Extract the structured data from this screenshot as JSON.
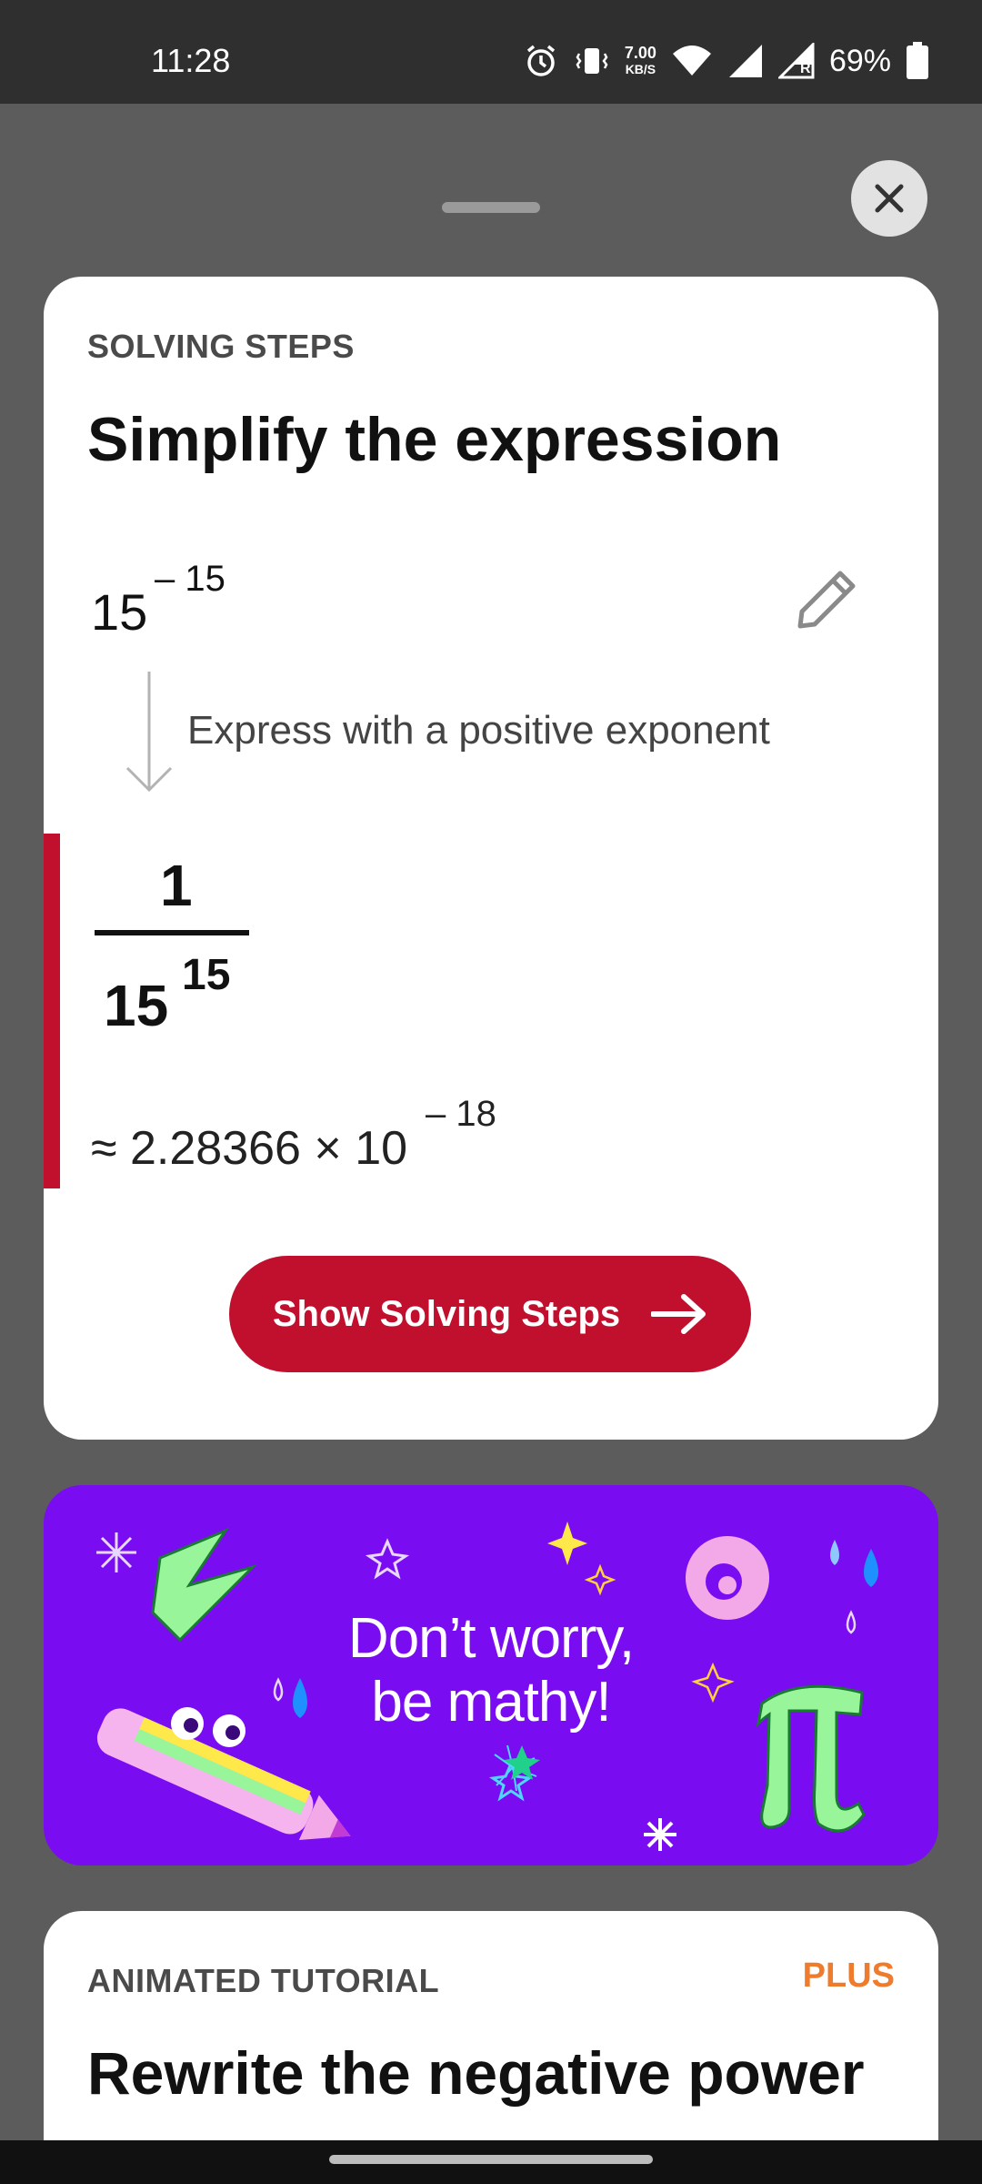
{
  "status_bar": {
    "time": "11:28",
    "netspeed_value": "7.00",
    "netspeed_unit": "KB/S",
    "battery_percent": "69%",
    "roaming_indicator": "R",
    "icons": [
      "alarm-icon",
      "vibrate-icon",
      "wifi-icon",
      "signal-icon",
      "signal-roaming-icon",
      "battery-icon"
    ]
  },
  "sheet": {
    "close_icon": "close-icon"
  },
  "solving_card": {
    "eyebrow": "SOLVING STEPS",
    "title": "Simplify the expression",
    "expression_base": "15",
    "expression_exponent": "– 15",
    "step_description": "Express with a positive exponent",
    "result_numerator": "1",
    "result_base": "15",
    "result_exponent": "15",
    "approximation": "≈ 2.28366 × 10",
    "approximation_exponent": "– 18",
    "button_label": "Show Solving Steps",
    "accent_color": "#c0102e"
  },
  "promo": {
    "line1": "Don’t worry,",
    "line2": "be mathy!",
    "background": "#7a0cf2"
  },
  "tutorial_card": {
    "eyebrow": "ANIMATED TUTORIAL",
    "badge": "PLUS",
    "title": "Rewrite the negative power",
    "badge_color": "#ef7b2d"
  }
}
